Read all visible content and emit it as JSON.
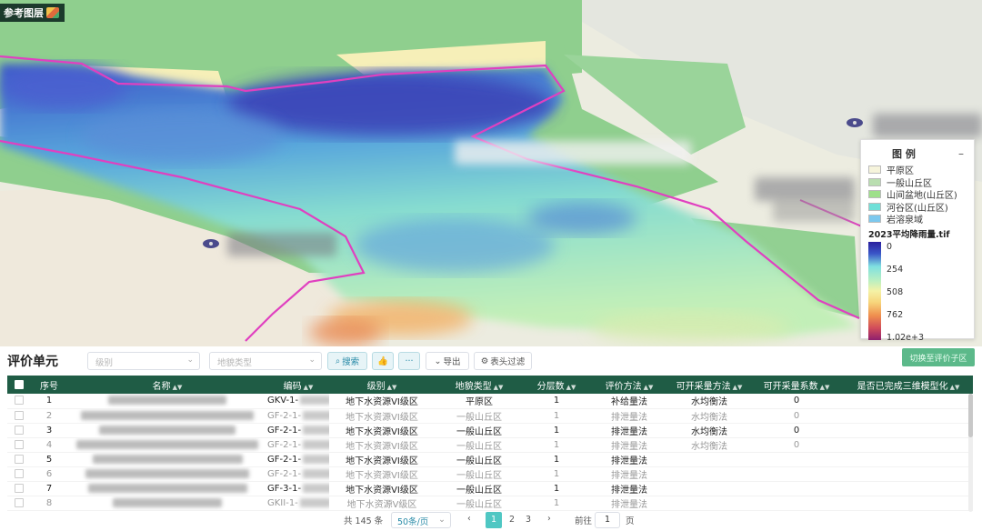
{
  "map": {
    "layer_button_label": "参考图层"
  },
  "legend": {
    "title": "图 例",
    "collapse_symbol": "–",
    "classes": [
      {
        "label": "平原区",
        "color": "#f6f4dc"
      },
      {
        "label": "一般山丘区",
        "color": "#b9deb0"
      },
      {
        "label": "山间盆地(山丘区)",
        "color": "#9ee08a"
      },
      {
        "label": "河谷区(山丘区)",
        "color": "#6fe0d8"
      },
      {
        "label": "岩溶泉域",
        "color": "#7cc8ee"
      }
    ],
    "raster_title": "2023平均降雨量.tif",
    "ramp_labels": [
      "0",
      "254",
      "508",
      "762",
      "1.02e+3"
    ]
  },
  "panel": {
    "title": "评价单元",
    "filter_level_placeholder": "级别",
    "filter_landform_placeholder": "地貌类型",
    "search_label": "搜索",
    "more_label": "···",
    "export_label": "导出",
    "column_filter_label": "表头过滤",
    "switch_label": "切换至评价子区"
  },
  "table": {
    "columns": [
      "序号",
      "名称",
      "编码",
      "级别",
      "地貌类型",
      "分层数",
      "评价方法",
      "可开采量方法",
      "可开采量系数",
      "是否已完成三维模型化"
    ],
    "rows": [
      {
        "index": "1",
        "code": "GKV-1-",
        "level": "地下水资源VI级区",
        "landform": "平原区",
        "layers": "1",
        "method": "补给量法",
        "mining_method": "水均衡法",
        "coefficient": "0",
        "dim": false
      },
      {
        "index": "2",
        "code": "GF-2-1-",
        "level": "地下水资源VI级区",
        "landform": "一般山丘区",
        "layers": "1",
        "method": "排泄量法",
        "mining_method": "水均衡法",
        "coefficient": "0",
        "dim": true
      },
      {
        "index": "3",
        "code": "GF-2-1-",
        "level": "地下水资源VI级区",
        "landform": "一般山丘区",
        "layers": "1",
        "method": "排泄量法",
        "mining_method": "水均衡法",
        "coefficient": "0",
        "dim": false
      },
      {
        "index": "4",
        "code": "GF-2-1-",
        "level": "地下水资源VI级区",
        "landform": "一般山丘区",
        "layers": "1",
        "method": "排泄量法",
        "mining_method": "水均衡法",
        "coefficient": "0",
        "dim": true
      },
      {
        "index": "5",
        "code": "GF-2-1-",
        "level": "地下水资源VI级区",
        "landform": "一般山丘区",
        "layers": "1",
        "method": "排泄量法",
        "mining_method": "",
        "coefficient": "",
        "dim": false
      },
      {
        "index": "6",
        "code": "GF-2-1-",
        "level": "地下水资源VI级区",
        "landform": "一般山丘区",
        "layers": "1",
        "method": "排泄量法",
        "mining_method": "",
        "coefficient": "",
        "dim": true
      },
      {
        "index": "7",
        "code": "GF-3-1-",
        "level": "地下水资源VI级区",
        "landform": "一般山丘区",
        "layers": "1",
        "method": "排泄量法",
        "mining_method": "",
        "coefficient": "",
        "dim": false
      },
      {
        "index": "8",
        "code": "GKII-1-",
        "level": "地下水资源V级区",
        "landform": "一般山丘区",
        "layers": "1",
        "method": "排泄量法",
        "mining_method": "",
        "coefficient": "",
        "dim": true
      }
    ]
  },
  "pager": {
    "total": "共 145 条",
    "page_size": "50条/页",
    "prev": "‹",
    "pages": [
      "1",
      "2",
      "3"
    ],
    "next": "›",
    "goto_prefix": "前往",
    "goto_value": "1",
    "goto_suffix": "页"
  },
  "colors": {
    "header_green": "#1f5c45",
    "active_page": "#4fc7c3",
    "boundary_magenta": "#e040c0"
  }
}
